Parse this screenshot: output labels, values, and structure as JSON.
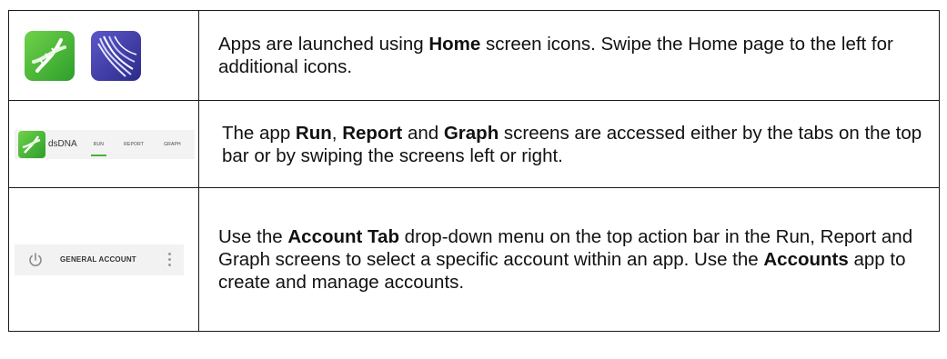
{
  "rows": [
    {
      "text_parts": [
        "Apps are launched using ",
        "Home",
        " screen icons. Swipe the Home page to the left for additional icons."
      ],
      "icons": [
        "dna-app-icon",
        "waveform-app-icon"
      ]
    },
    {
      "text_parts": [
        "The app ",
        "Run",
        ", ",
        "Report",
        " and ",
        "Graph",
        " screens are accessed either by the tabs on the top bar or by swiping the screens left or right."
      ],
      "tab_bar": {
        "title": "dsDNA",
        "tabs": [
          "RUN",
          "REPORT",
          "GRAPH"
        ],
        "active_tab": "RUN",
        "accent_color": "#4caf3b"
      }
    },
    {
      "text_parts": [
        "Use the ",
        "Account Tab",
        " drop-down menu on the top action bar in the Run, Report and Graph screens to select a specific account within an app.  Use the ",
        "Accounts",
        " app to create and manage accounts."
      ],
      "account_bar": {
        "label": "GENERAL ACCOUNT",
        "icons": [
          "power-icon",
          "overflow-menu-icon"
        ]
      }
    }
  ]
}
